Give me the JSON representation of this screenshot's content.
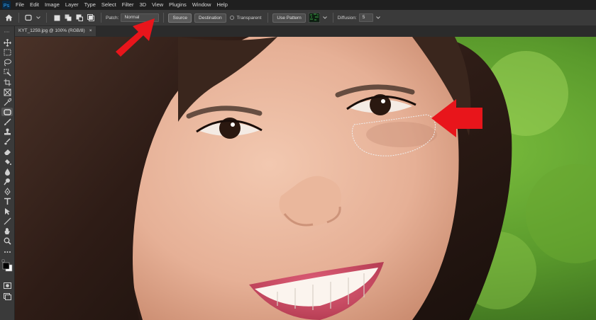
{
  "menu": {
    "app_icon": "photoshop-logo",
    "items": [
      "File",
      "Edit",
      "Image",
      "Layer",
      "Type",
      "Select",
      "Filter",
      "3D",
      "View",
      "Plugins",
      "Window",
      "Help"
    ]
  },
  "options": {
    "patch_label": "Patch:",
    "patch_mode": "Normal",
    "source_label": "Source",
    "destination_label": "Destination",
    "transparent_label": "Transparent",
    "use_pattern_label": "Use Pattern",
    "diffusion_label": "Diffusion:",
    "diffusion_value": "5"
  },
  "document": {
    "tab_title": "KYT_1259.jpg @ 100% (RGB/8)",
    "close_glyph": "×"
  },
  "colors": {
    "arrow": "#e8151b",
    "selection": "#f0f0f0"
  }
}
